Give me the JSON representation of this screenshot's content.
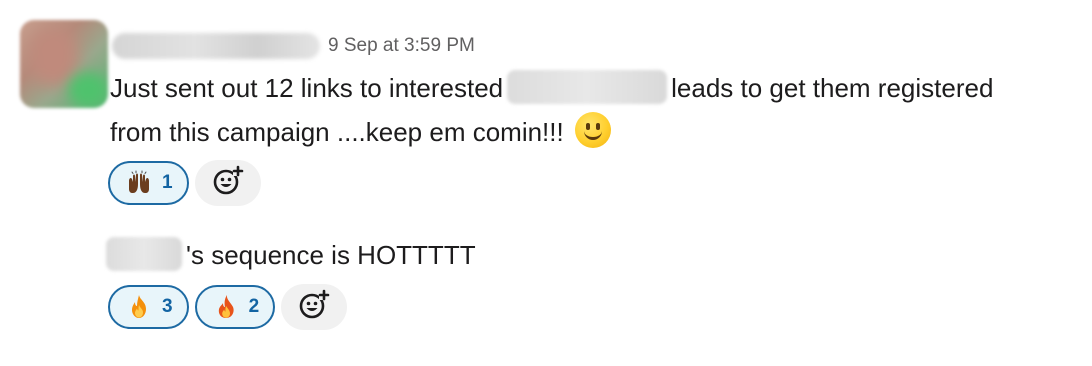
{
  "message1": {
    "timestamp": "9 Sep at 3:59 PM",
    "text_before": "Just sent out 12 links to interested",
    "text_after": "leads to get them registered from this campaign ....keep em comin!!!",
    "emoji": "slightly-smiling-face",
    "reactions": [
      {
        "emoji": "raised-hands",
        "count": "1"
      }
    ]
  },
  "message2": {
    "text_after": "'s sequence is HOTTTTT",
    "reactions": [
      {
        "emoji": "fire",
        "count": "3"
      },
      {
        "emoji": "fire-alt",
        "count": "2"
      }
    ]
  },
  "colors": {
    "reaction_border": "#1d6aa3",
    "reaction_bg": "#e8f5fa",
    "reaction_count": "#1264a3",
    "timestamp": "#616061",
    "text": "#1d1c1d"
  },
  "icons": {
    "add_reaction": "add-emoji-icon"
  }
}
